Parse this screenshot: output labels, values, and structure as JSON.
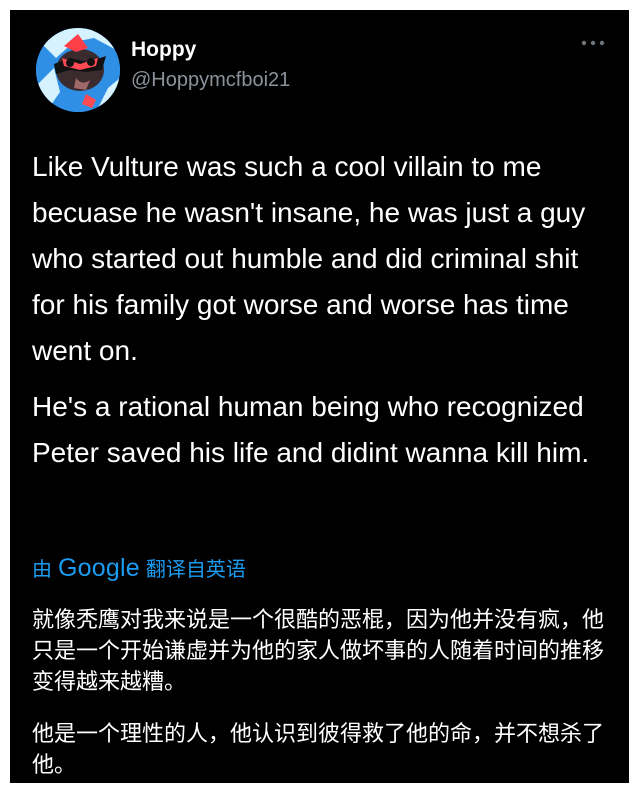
{
  "tweet": {
    "author": {
      "name": "Hoppy",
      "handle": "@Hoppymcfboi21"
    },
    "more_icon": "more-horizontal-icon",
    "paragraphs": [
      "Like Vulture was such a cool villain to me becuase he wasn't insane, he was just a guy who started out humble and did criminal shit for his family got worse and worse has time went on.",
      "He's a rational human being who recognized Peter saved his life and didint wanna kill him."
    ]
  },
  "translation": {
    "by_label": "由",
    "provider": "Google",
    "note": "翻译自英语",
    "paragraphs": [
      "就像秃鹰对我来说是一个很酷的恶棍，因为他并没有疯，他只是一个开始谦虚并为他的家人做坏事的人随着时间的推移变得越来越糟。",
      "他是一个理性的人，他认识到彼得救了他的命，并不想杀了他。"
    ]
  },
  "colors": {
    "background": "#000000",
    "text_primary": "#ffffff",
    "text_secondary": "#8b9299",
    "link_blue": "#1d9bf0"
  }
}
